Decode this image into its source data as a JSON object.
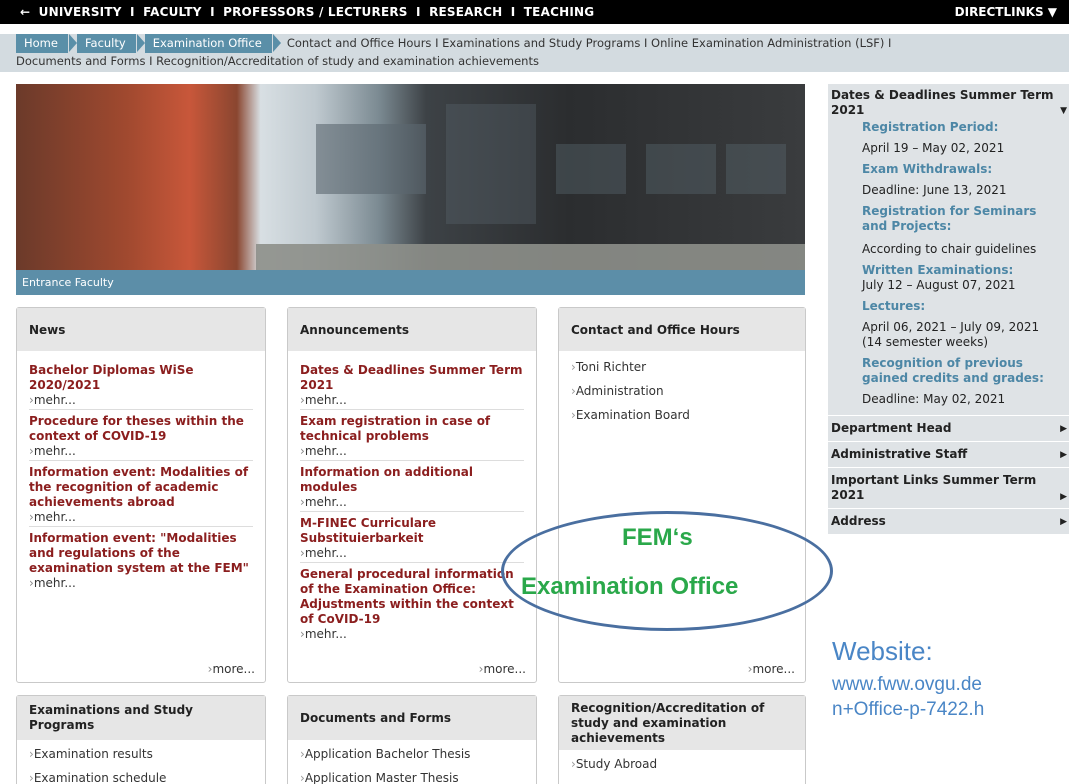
{
  "topbar": {
    "arrow": "←",
    "items": [
      "UNIVERSITY",
      "FACULTY",
      "PROFESSORS / LECTURERS",
      "RESEARCH",
      "TEACHING"
    ],
    "separator": "I",
    "directlinks": "DIRECTLINKS ▼"
  },
  "nav": {
    "breadcrumb": [
      "Home",
      "Faculty",
      "Examination Office"
    ],
    "links_line1": "Contact and Office Hours  I  Examinations and Study Programs  I  Online Examination Administration (LSF)  I",
    "links_line2": "Documents and Forms  I  Recognition/Accreditation of study and examination achievements"
  },
  "hero": {
    "caption": "Entrance Faculty"
  },
  "news": {
    "title": "News",
    "items": [
      {
        "title": "Bachelor Diplomas WiSe 2020/2021",
        "more": "mehr..."
      },
      {
        "title": "Procedure for theses within the context of COVID-19",
        "more": "mehr..."
      },
      {
        "title": "Information event: Modalities of the recognition of academic achievements abroad",
        "more": "mehr..."
      },
      {
        "title": "Information event: \"Modalities and regulations of the examination system at the FEM\"",
        "more": "mehr..."
      }
    ],
    "more": "more..."
  },
  "announcements": {
    "title": "Announcements",
    "items": [
      {
        "title": "Dates & Deadlines Summer Term 2021",
        "more": "mehr..."
      },
      {
        "title": "Exam registration in case of technical problems",
        "more": "mehr..."
      },
      {
        "title": "Information on additional modules",
        "more": "mehr..."
      },
      {
        "title": "M-FINEC Curriculare Substituierbarkeit",
        "more": "mehr..."
      },
      {
        "title": "General procedural information of the Examination Office: Adjustments within the context of CoVID-19",
        "more": "mehr..."
      }
    ],
    "more": "more..."
  },
  "contact": {
    "title": "Contact and Office Hours",
    "links": [
      "Toni Richter",
      "Administration",
      "Examination Board"
    ],
    "more": "more..."
  },
  "exams": {
    "title": "Examinations and Study Programs",
    "links": [
      "Examination results",
      "Examination schedule"
    ]
  },
  "documents": {
    "title": "Documents and Forms",
    "links": [
      "Application Bachelor Thesis",
      "Application Master Thesis"
    ]
  },
  "recognition": {
    "title": "Recognition/Accreditation of study and examination achievements",
    "links": [
      "Study Abroad"
    ]
  },
  "sidebar": {
    "dates_title": "Dates & Deadlines Summer Term 2021",
    "entries": [
      {
        "label": "Registration Period:",
        "value": "April 19 – May 02, 2021"
      },
      {
        "label": "Exam Withdrawals:",
        "value": "Deadline: June 13, 2021"
      },
      {
        "label": "Registration for Seminars and Projects:",
        "value": "According to chair guidelines"
      },
      {
        "label": "Written Examinations:",
        "value": "July 12 – August 07, 2021"
      },
      {
        "label": "Lectures:",
        "value": "April 06, 2021  – July 09, 2021 (14 semester weeks)"
      },
      {
        "label": "Recognition of previous gained credits and grades:",
        "value": "Deadline: May 02, 2021"
      }
    ],
    "sections": [
      "Department Head",
      "Administrative Staff",
      "Important Links Summer Term 2021",
      "Address"
    ]
  },
  "overlay": {
    "fem_line1": "FEM‘s",
    "fem_line2": "Examination Office",
    "website_label": "Website:",
    "website_line1": "www.fww.ovgu.de",
    "website_line2": "n+Office-p-7422.h"
  },
  "colors": {
    "topbar": "#000000",
    "nav_bg": "#d3dbe0",
    "breadcrumb": "#5a8fa8",
    "item_title": "#8b1e1e",
    "sidebar_label": "#4d87a6",
    "overlay_green": "#2aa84a",
    "overlay_blue": "#4a86c6"
  }
}
